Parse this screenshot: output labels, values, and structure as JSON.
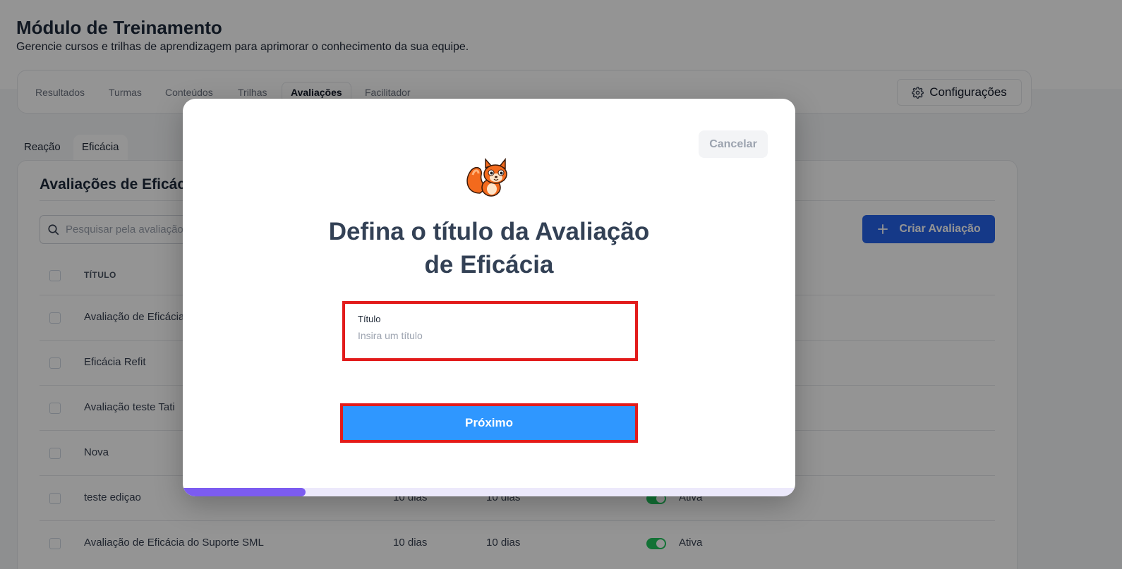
{
  "header": {
    "title": "Módulo de Treinamento",
    "subtitle": "Gerencie cursos e trilhas de aprendizagem para aprimorar o conhecimento da sua equipe."
  },
  "main_tabs": [
    {
      "label": "Resultados",
      "active": false
    },
    {
      "label": "Turmas",
      "active": false
    },
    {
      "label": "Conteúdos",
      "active": false
    },
    {
      "label": "Trilhas",
      "active": false
    },
    {
      "label": "Avaliações",
      "active": true
    },
    {
      "label": "Facilitador",
      "active": false
    }
  ],
  "config_button": {
    "label": "Configurações",
    "icon": "gear-icon"
  },
  "sub_tabs": [
    {
      "label": "Reação",
      "active": false
    },
    {
      "label": "Eficácia",
      "active": true
    }
  ],
  "list": {
    "title": "Avaliações de Eficácia",
    "search_placeholder": "Pesquisar pela avaliação",
    "create_button": "Criar Avaliação",
    "column_title": "TÍTULO",
    "rows": [
      {
        "title": "Avaliação de Eficácia...",
        "col2": "",
        "col3": "",
        "status": ""
      },
      {
        "title": "Eficácia Refit",
        "col2": "",
        "col3": "",
        "status": ""
      },
      {
        "title": "Avaliação teste Tati",
        "col2": "",
        "col3": "",
        "status": ""
      },
      {
        "title": "Nova",
        "col2": "",
        "col3": "",
        "status": ""
      },
      {
        "title": "teste ediçao",
        "col2": "10 dias",
        "col3": "10 dias",
        "status": "Ativa"
      },
      {
        "title": "Avaliação de Eficácia do Suporte SML",
        "col2": "10 dias",
        "col3": "10 dias",
        "status": "Ativa"
      }
    ]
  },
  "modal": {
    "cancel_label": "Cancelar",
    "title_line1": "Defina o título da Avaliação",
    "title_line2": "de Eficácia",
    "field_label": "Título",
    "field_value": "",
    "field_placeholder": "Insira um título",
    "next_label": "Próximo",
    "progress": 0.2
  },
  "colors": {
    "primary": "#2563eb",
    "next_button": "#2f97ff",
    "highlight": "#e21b1b",
    "progress": "#7c5cf0",
    "toggle_on": "#22c55e"
  }
}
